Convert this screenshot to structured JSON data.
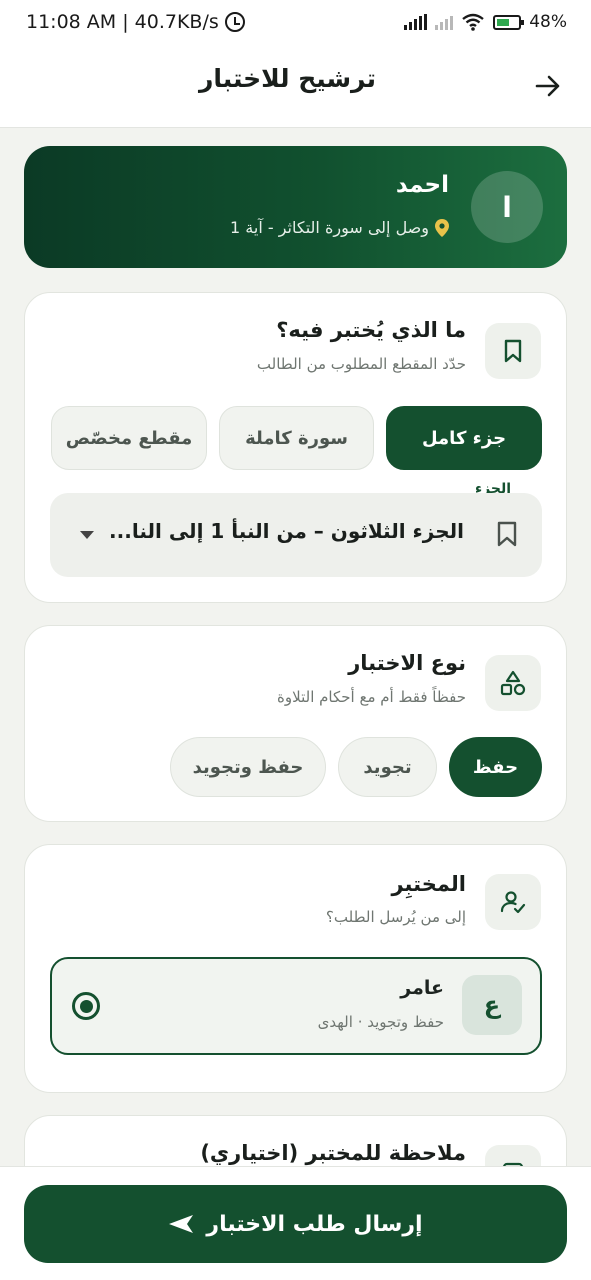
{
  "status_bar": {
    "time_speed": "11:08 AM | 40.7KB/s",
    "battery": "48%"
  },
  "header": {
    "title": "ترشيح للاختبار"
  },
  "student": {
    "initial": "ا",
    "name": "احمد",
    "progress": "وصل إلى سورة التكاثر - آية 1"
  },
  "section_scope": {
    "title": "ما الذي يُختبر فيه؟",
    "subtitle": "حدّد المقطع المطلوب من الطالب",
    "options": [
      "جزء كامل",
      "سورة كاملة",
      "مقطع مخصّص"
    ],
    "selected": "جزء كامل",
    "field_label": "الجزء",
    "field_value": "الجزء الثلاثون – من النبأ 1 إلى النا..."
  },
  "section_type": {
    "title": "نوع الاختبار",
    "subtitle": "حفظاً فقط أم مع أحكام التلاوة",
    "options": [
      "حفظ",
      "تجويد",
      "حفظ وتجويد"
    ],
    "selected": "حفظ"
  },
  "section_examiner": {
    "title": "المختبِر",
    "subtitle": "إلى من يُرسل الطلب؟",
    "examiner": {
      "initial": "ع",
      "name": "عامر",
      "details": "حفظ وتجويد · الهدى"
    }
  },
  "section_note": {
    "title": "ملاحظة للمختبر (اختياري)"
  },
  "submit": {
    "label": "إرسال طلب الاختبار"
  }
}
